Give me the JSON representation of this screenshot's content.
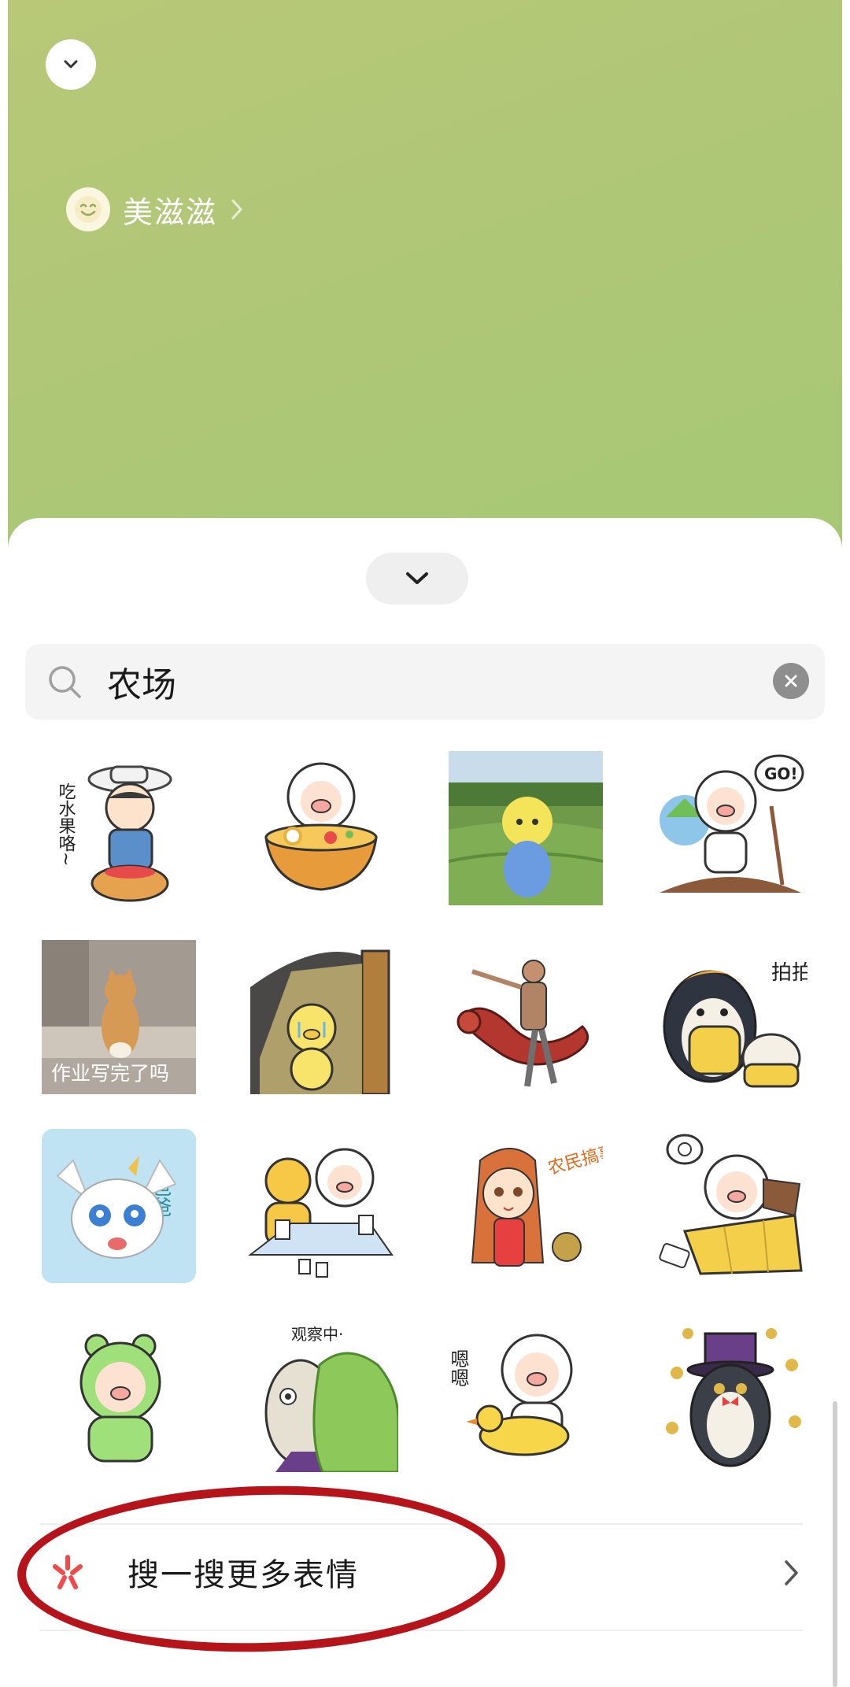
{
  "header": {
    "collapse_icon": "chevron-down-icon",
    "profile": {
      "avatar_icon": "smiley-face-icon",
      "name": "美滋滋"
    }
  },
  "sheet": {
    "handle_icon": "chevron-down-icon",
    "search": {
      "query": "农场",
      "clear_icon": "clear-icon"
    },
    "stickers": [
      {
        "name": "sticker-eat-fruit",
        "caption": "吃水果咯~"
      },
      {
        "name": "sticker-pig-noodles",
        "caption": ""
      },
      {
        "name": "sticker-farm-photo",
        "caption": ""
      },
      {
        "name": "sticker-pig-go",
        "caption": "GO!"
      },
      {
        "name": "sticker-cat-homework",
        "caption": "作业写完了吗"
      },
      {
        "name": "sticker-pig-crying",
        "caption": ""
      },
      {
        "name": "sticker-dragon-rider",
        "caption": ""
      },
      {
        "name": "sticker-penguin-pat",
        "caption": "拍拍"
      },
      {
        "name": "sticker-white-creature",
        "caption": "爸爸"
      },
      {
        "name": "sticker-pig-cards",
        "caption": ""
      },
      {
        "name": "sticker-girl-farm",
        "caption": "农民搞事啦"
      },
      {
        "name": "sticker-pig-bed",
        "caption": ""
      },
      {
        "name": "sticker-pig-frog",
        "caption": ""
      },
      {
        "name": "sticker-observing",
        "caption": "观察中·"
      },
      {
        "name": "sticker-pig-duck",
        "caption": "嗯嗯"
      },
      {
        "name": "sticker-penguin-coins",
        "caption": ""
      }
    ],
    "search_more": {
      "icon": "sou-yi-sou-icon",
      "label": "搜一搜更多表情",
      "chevron_icon": "chevron-right-icon"
    }
  },
  "colors": {
    "header_bg": "#afc777",
    "annotation_red": "#b5141b",
    "sou_icon": "#f04a4a"
  }
}
